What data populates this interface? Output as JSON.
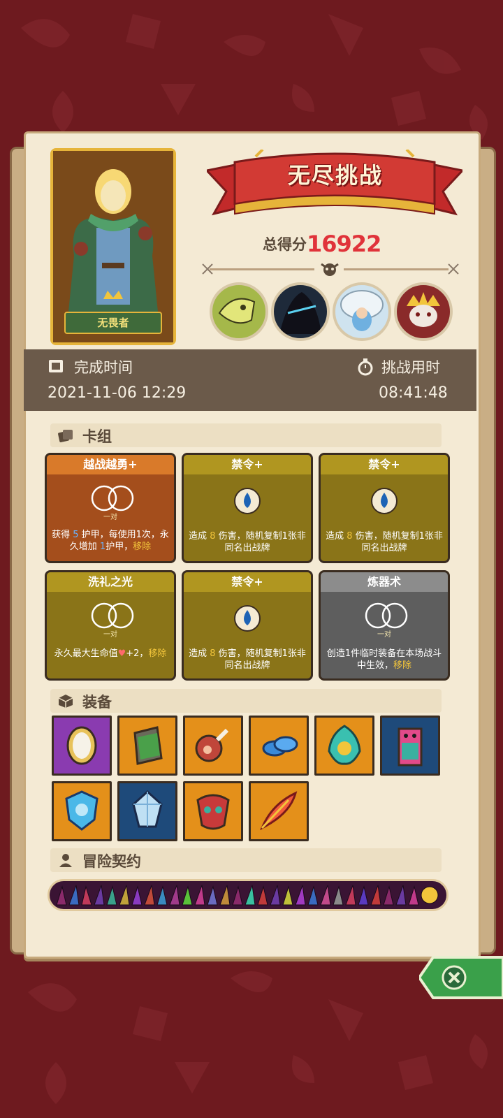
{
  "hero": {
    "name": "无畏者"
  },
  "challenge": {
    "title": "无尽挑战",
    "score_label": "总得分",
    "score_value": "16922"
  },
  "info": {
    "finish_time_label": "完成时间",
    "finish_time_value": "2021-11-06 12:29",
    "duration_label": "挑战用时",
    "duration_value": "08:41:48"
  },
  "deck": {
    "header": "卡组",
    "cards": [
      {
        "title": "越战越勇+",
        "pair": "一对",
        "color": "orange",
        "text_parts": [
          "获得 ",
          "5",
          " 护甲，每使用1次，永久增加 ",
          "1",
          "护甲，",
          "移除"
        ]
      },
      {
        "title": "禁令+",
        "pair": "",
        "color": "olive",
        "text_parts": [
          "造成 ",
          "8",
          " 伤害，随机复制1张非同名出战牌"
        ]
      },
      {
        "title": "禁令+",
        "pair": "",
        "color": "olive",
        "text_parts": [
          "造成 ",
          "8",
          " 伤害，随机复制1张非同名出战牌"
        ]
      },
      {
        "title": "洗礼之光",
        "pair": "一对",
        "color": "olive",
        "text_parts": [
          "永久最大生命值",
          "+2，",
          "移除"
        ]
      },
      {
        "title": "禁令+",
        "pair": "",
        "color": "olive",
        "text_parts": [
          "造成 ",
          "8",
          " 伤害，随机复制1张非同名出战牌"
        ]
      },
      {
        "title": "炼器术",
        "pair": "一对",
        "color": "gray",
        "text_parts": [
          "创造1件临时装备在本场战斗中生效，",
          "移除"
        ]
      }
    ]
  },
  "equipment": {
    "header": "装备",
    "items": [
      {
        "name": "mirror-icon",
        "bg": "#8a3bb0"
      },
      {
        "name": "moss-stone-icon",
        "bg": "#e4901a"
      },
      {
        "name": "meat-icon",
        "bg": "#e4901a"
      },
      {
        "name": "blue-slime-icon",
        "bg": "#e4901a"
      },
      {
        "name": "flame-mask-icon",
        "bg": "#e4901a"
      },
      {
        "name": "totem-icon",
        "bg": "#1e4a7a"
      },
      {
        "name": "ice-shield-icon",
        "bg": "#e4901a"
      },
      {
        "name": "diamond-gem-icon",
        "bg": "#1e4a7a"
      },
      {
        "name": "tribal-mask-icon",
        "bg": "#e4901a"
      },
      {
        "name": "phoenix-feather-icon",
        "bg": "#e4901a"
      }
    ]
  },
  "contract": {
    "header": "冒险契约"
  },
  "colors": {
    "background": "#6e1a1f",
    "paper": "#f4ead4",
    "score": "#e0333a",
    "info_bar": "#6b5a4a",
    "card_orange": "#b0571e",
    "card_olive": "#8a7418",
    "card_gray": "#5e5e5e"
  }
}
